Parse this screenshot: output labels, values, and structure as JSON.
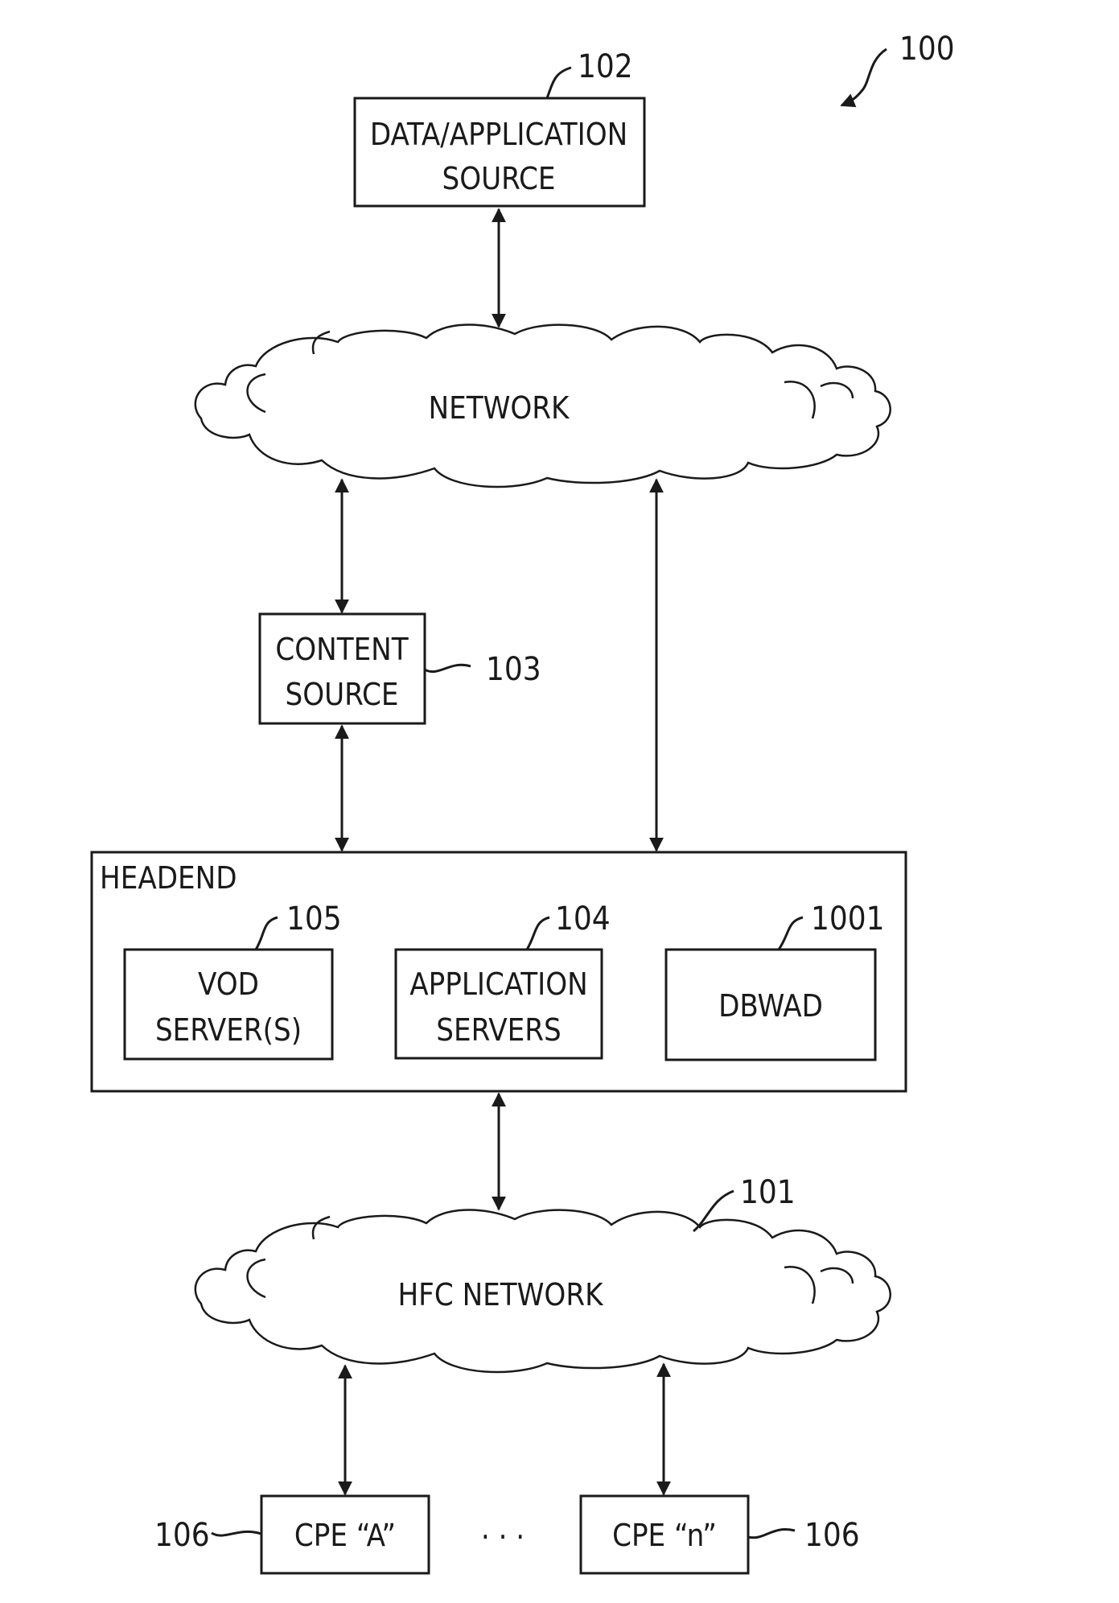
{
  "figure": {
    "ref_number": "100",
    "nodes": {
      "data_app_source": {
        "line1": "DATA/APPLICATION",
        "line2": "SOURCE",
        "ref": "102"
      },
      "network": {
        "label": "NETWORK"
      },
      "content_source": {
        "line1": "CONTENT",
        "line2": "SOURCE",
        "ref": "103"
      },
      "headend": {
        "label": "HEADEND",
        "vod": {
          "line1": "VOD",
          "line2": "SERVER(S)",
          "ref": "105"
        },
        "app_servers": {
          "line1": "APPLICATION",
          "line2": "SERVERS",
          "ref": "104"
        },
        "dbwad": {
          "label": "DBWAD",
          "ref": "1001"
        }
      },
      "hfc_network": {
        "label": "HFC  NETWORK",
        "ref": "101"
      },
      "cpe_a": {
        "label": "CPE “A”",
        "ref": "106"
      },
      "cpe_n": {
        "label": "CPE “n”",
        "ref": "106"
      },
      "ellipsis": ". . ."
    },
    "colors": {
      "ink": "#1a1a1a",
      "background": "#ffffff"
    }
  }
}
